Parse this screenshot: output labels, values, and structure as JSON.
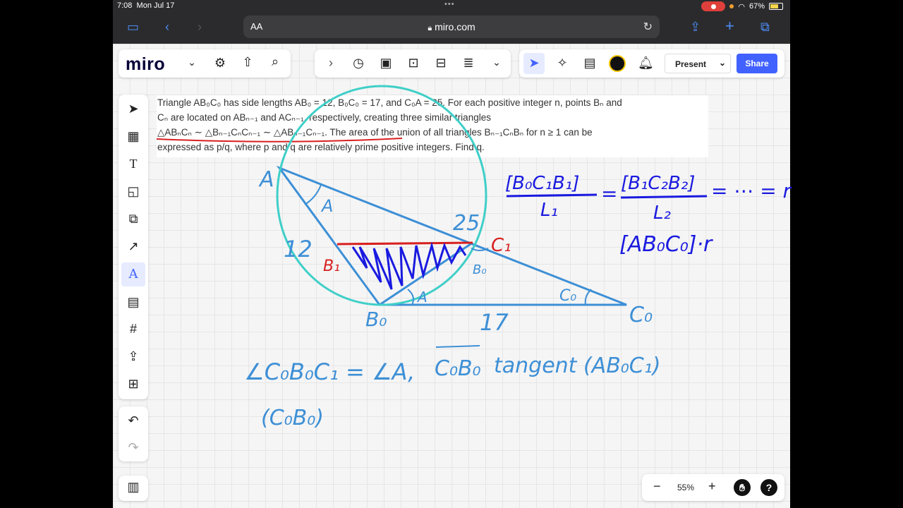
{
  "status": {
    "time": "7:08",
    "date": "Mon Jul 17",
    "battery": "67%"
  },
  "browser": {
    "text_size": "AA",
    "url": "miro.com"
  },
  "miro": {
    "logo": "miro",
    "present_label": "Present",
    "share_label": "Share",
    "zoom_level": "55%"
  },
  "problem": {
    "line1": "Triangle AB₀C₀ has side lengths AB₀ = 12, B₀C₀ = 17, and C₀A = 25. For each positive integer n, points Bₙ and",
    "line2": "Cₙ are located on ABₙ₋₁ and ACₙ₋₁, respectively, creating three similar triangles",
    "line3": "△ABₙCₙ ∼ △Bₙ₋₁CₙCₙ₋₁ ∼ △ABₙ₋₁Cₙ₋₁. The area of the union of all triangles Bₙ₋₁CₙBₙ for n ≥ 1 can be",
    "line4": "expressed as p/q, where p and q are relatively prime positive integers. Find q."
  },
  "handwriting": {
    "A": "A",
    "A_angle_top": "A",
    "side_12": "12",
    "side_25": "25",
    "C1": "C₁",
    "B1": "B₁",
    "B0_small": "B₀",
    "C0_angle": "C₀",
    "B0": "B₀",
    "A_angle_bottom": "A",
    "side_17": "17",
    "C0": "C₀",
    "ratio_num1": "[B₀C₁B₁]",
    "ratio_den1": "L₁",
    "eq1": "=",
    "ratio_num2": "[B₁C₂B₂]",
    "ratio_den2": "L₂",
    "eq2": "= ⋯ = r",
    "area_expr": "[AB₀C₀]·r",
    "angle_eq": "∠C₀B₀C₁ = ∠A,",
    "tangent_seg": "C₀B₀",
    "tangent_text": "tangent (AB₀C₁)",
    "paren_note": "(C₀B₀)"
  },
  "colors": {
    "ink_blue": "#3d8fd6",
    "ink_dark_blue": "#1a1ae0",
    "ink_red": "#d82020",
    "circle": "#3fcfc8",
    "share": "#4262ff"
  }
}
